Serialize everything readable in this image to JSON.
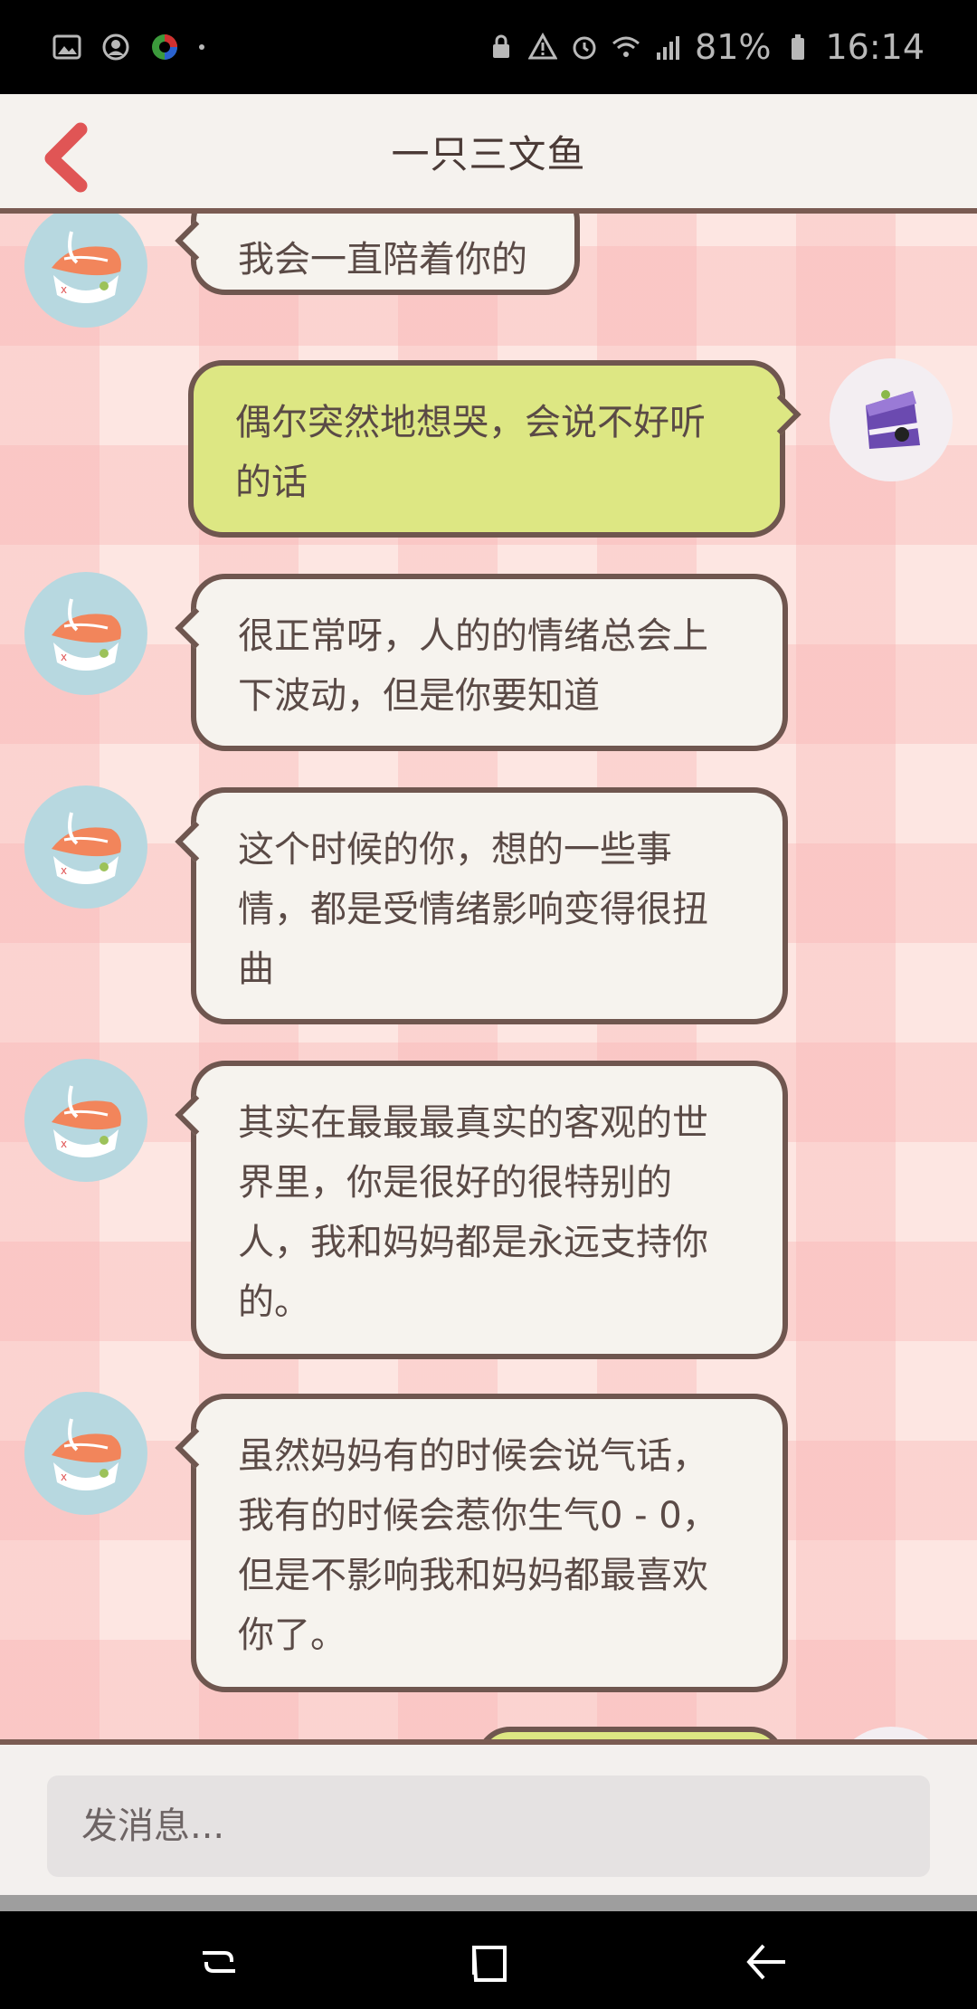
{
  "status_bar": {
    "battery": "81%",
    "time": "16:14",
    "left_icons": [
      "image-icon",
      "account-icon",
      "color-circle-icon"
    ],
    "right_icons": [
      "lock-icon",
      "alert-icon",
      "alarm-icon",
      "wifi-icon",
      "signal-icon",
      "battery-icon"
    ]
  },
  "header": {
    "title": "一只三文鱼",
    "back_icon": "chevron-left-icon",
    "accent": "#e05555"
  },
  "messages": [
    {
      "sender": "bot",
      "text": "我会一直陪着你的"
    },
    {
      "sender": "me",
      "text": "偶尔突然地想哭，会说不好听的话"
    },
    {
      "sender": "bot",
      "text": "很正常呀，人的的情绪总会上下波动，但是你要知道"
    },
    {
      "sender": "bot",
      "text": "这个时候的你，想的一些事情，都是受情绪影响变得很扭曲"
    },
    {
      "sender": "bot",
      "text": "其实在最最最真实的客观的世界里，你是很好的很特别的人，我和妈妈都是永远支持你的。"
    },
    {
      "sender": "bot",
      "text": "虽然妈妈有的时候会说气话，我有的时候会惹你生气0 - 0，但是不影响我和妈妈都最喜欢你了。"
    }
  ],
  "input": {
    "placeholder": "发消息..."
  },
  "nav": {
    "icons": [
      "recent-apps-icon",
      "home-icon",
      "back-icon"
    ]
  }
}
